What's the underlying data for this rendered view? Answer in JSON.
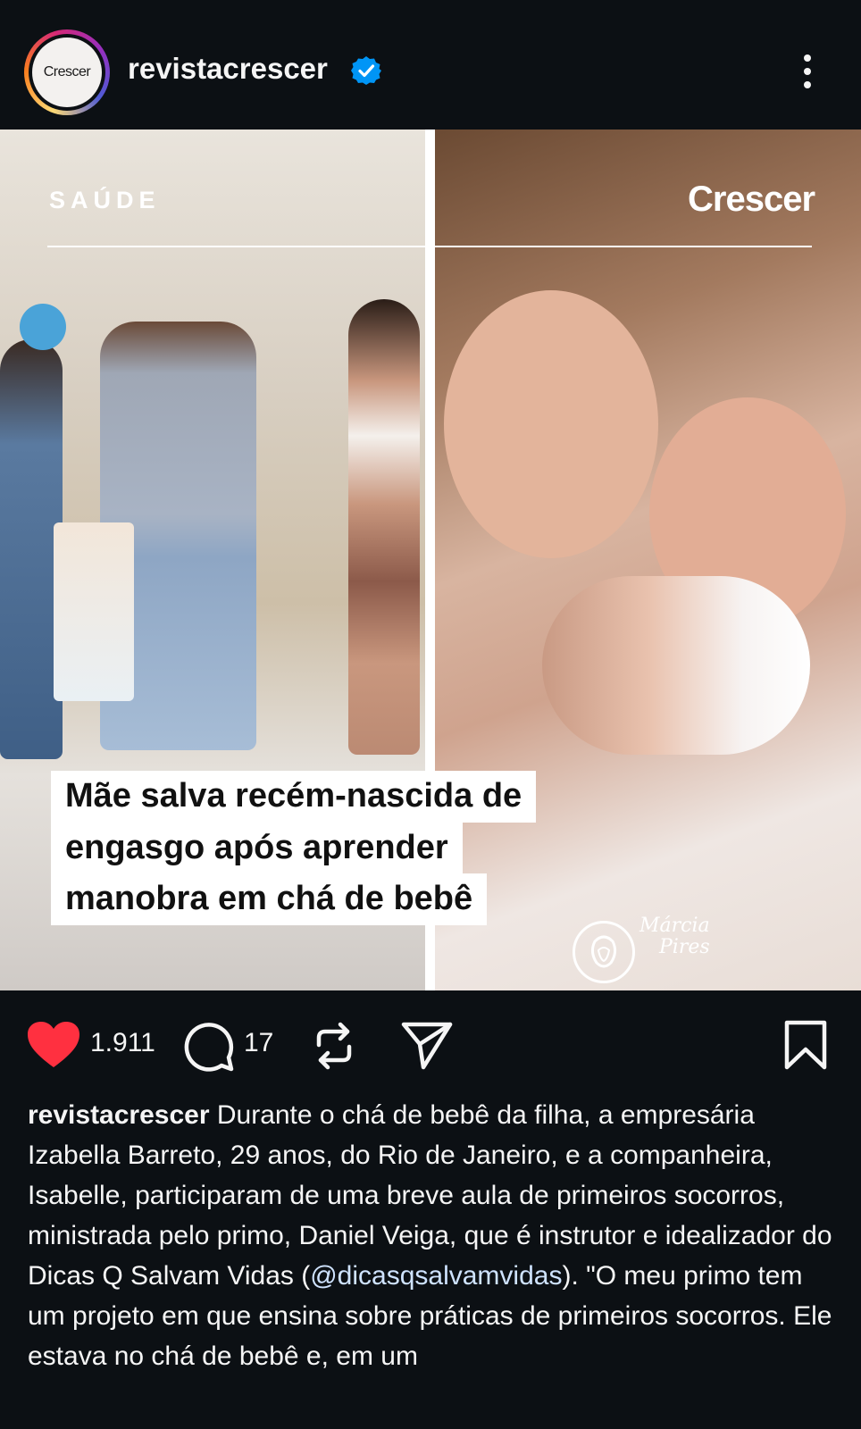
{
  "header": {
    "avatar_text": "Crescer",
    "username": "revistacrescer",
    "verified_icon": "verified-badge-icon",
    "more_icon": "more-vertical-icon"
  },
  "post": {
    "section_label": "SAÚDE",
    "brand_label": "Crescer",
    "headline_lines": [
      "Mãe salva recém-nascida de",
      "engasgo após aprender",
      "manobra em chá de bebê"
    ],
    "photo_credit_line1": "Márcia",
    "photo_credit_line2": "Pires"
  },
  "actions": {
    "like_icon": "heart-filled-icon",
    "like_color": "#ff3040",
    "likes": "1.911",
    "comment_icon": "comment-icon",
    "comments": "17",
    "repost_icon": "repost-icon",
    "share_icon": "send-icon",
    "save_icon": "bookmark-icon"
  },
  "caption": {
    "username": "revistacrescer",
    "text_before": " Durante o chá de bebê da filha, a empresária Izabella Barreto, 29 anos, do Rio de Janeiro, e a companheira, Isabelle, participaram de uma breve aula de primeiros socorros, ministrada pelo primo, Daniel Veiga, que é instrutor e idealizador do Dicas Q Salvam Vidas (",
    "mention": "@dicasqsalvamvidas",
    "text_after": "). \"O meu primo tem um projeto em que ensina sobre práticas de primeiros socorros. Ele estava no chá de bebê e, em um"
  }
}
